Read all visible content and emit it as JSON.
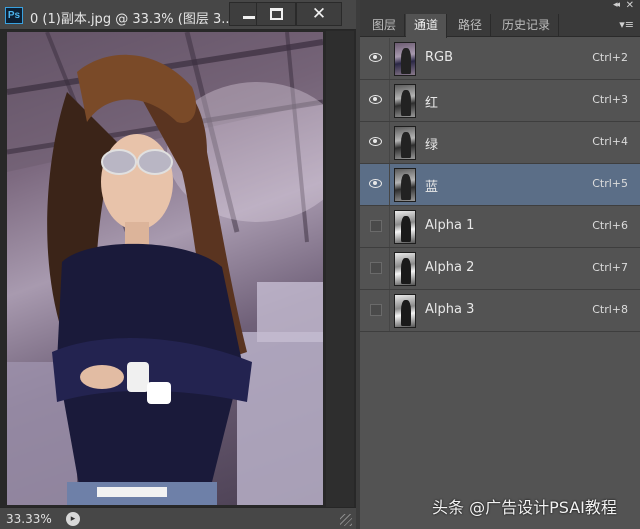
{
  "document": {
    "app_logo": "Ps",
    "title": "0 (1)副本.jpg @ 33.3% (图层 3...",
    "zoom": "33.33%",
    "window_buttons": {
      "minimize": "minimize-icon",
      "maximize": "maximize-icon",
      "close": "✕"
    }
  },
  "panel": {
    "tabs": [
      {
        "label": "图层",
        "active": false
      },
      {
        "label": "通道",
        "active": true
      },
      {
        "label": "路径",
        "active": false
      },
      {
        "label": "历史记录",
        "active": false
      }
    ],
    "collapse_glyph": "◂◂",
    "close_glyph": "✕",
    "menu_glyph": "▾≡",
    "channels": [
      {
        "name": "RGB",
        "shortcut": "Ctrl+2",
        "visible": true,
        "selected": false,
        "thumb": "color"
      },
      {
        "name": "红",
        "shortcut": "Ctrl+3",
        "visible": true,
        "selected": false,
        "thumb": "gray"
      },
      {
        "name": "绿",
        "shortcut": "Ctrl+4",
        "visible": true,
        "selected": false,
        "thumb": "gray"
      },
      {
        "name": "蓝",
        "shortcut": "Ctrl+5",
        "visible": true,
        "selected": true,
        "thumb": "gray"
      },
      {
        "name": "Alpha 1",
        "shortcut": "Ctrl+6",
        "visible": false,
        "selected": false,
        "thumb": "alpha"
      },
      {
        "name": "Alpha 2",
        "shortcut": "Ctrl+7",
        "visible": false,
        "selected": false,
        "thumb": "alpha"
      },
      {
        "name": "Alpha 3",
        "shortcut": "Ctrl+8",
        "visible": false,
        "selected": false,
        "thumb": "alpha"
      }
    ]
  },
  "watermark": "头条 @广告设计PSAI教程",
  "colors": {
    "selected_row": "#5b6e87",
    "panel_bg": "#535353",
    "titlebar_bg": "#474747"
  }
}
